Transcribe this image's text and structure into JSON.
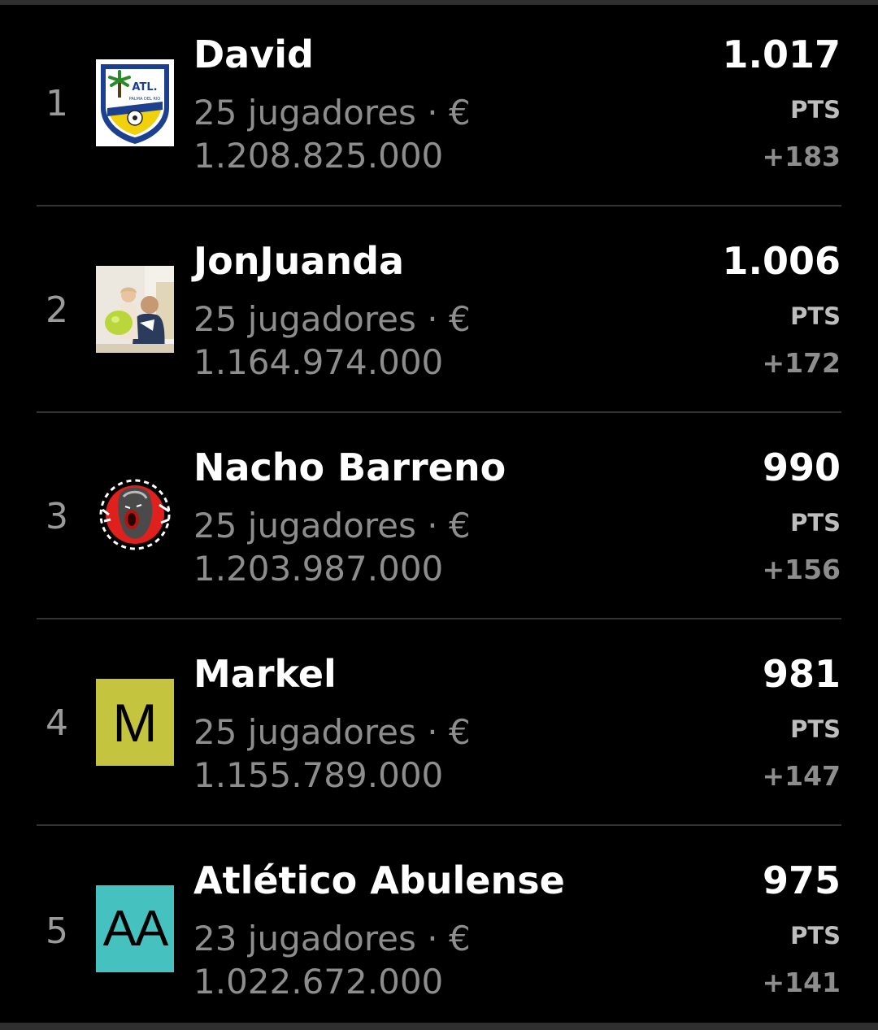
{
  "standings": [
    {
      "rank": "1",
      "name": "David",
      "players": "25 jugadores · €",
      "value": "1.208.825.000",
      "points": "1.017",
      "points_label": "PTS",
      "delta": "+183",
      "avatar": {
        "type": "crest",
        "icon": "club-crest-icon",
        "text": "ATL.",
        "subtext": "PALMA DEL RIO"
      }
    },
    {
      "rank": "2",
      "name": "JonJuanda",
      "players": "25 jugadores · €",
      "value": "1.164.974.000",
      "points": "1.006",
      "points_label": "PTS",
      "delta": "+172",
      "avatar": {
        "type": "photo",
        "icon": "user-photo-icon"
      }
    },
    {
      "rank": "3",
      "name": "Nacho Barreno",
      "players": "25 jugadores · €",
      "value": "1.203.987.000",
      "points": "990",
      "points_label": "PTS",
      "delta": "+156",
      "avatar": {
        "type": "logo",
        "icon": "screaming-face-logo-icon"
      }
    },
    {
      "rank": "4",
      "name": "Markel",
      "players": "25 jugadores · €",
      "value": "1.155.789.000",
      "points": "981",
      "points_label": "PTS",
      "delta": "+147",
      "avatar": {
        "type": "initials",
        "icon": "initials-avatar-icon",
        "initials": "M",
        "color": "#c4c43e"
      }
    },
    {
      "rank": "5",
      "name": "Atlético Abulense",
      "players": "23 jugadores · €",
      "value": "1.022.672.000",
      "points": "975",
      "points_label": "PTS",
      "delta": "+141",
      "avatar": {
        "type": "initials",
        "icon": "initials-avatar-icon",
        "initials": "AA",
        "color": "#45c2c0"
      }
    }
  ]
}
